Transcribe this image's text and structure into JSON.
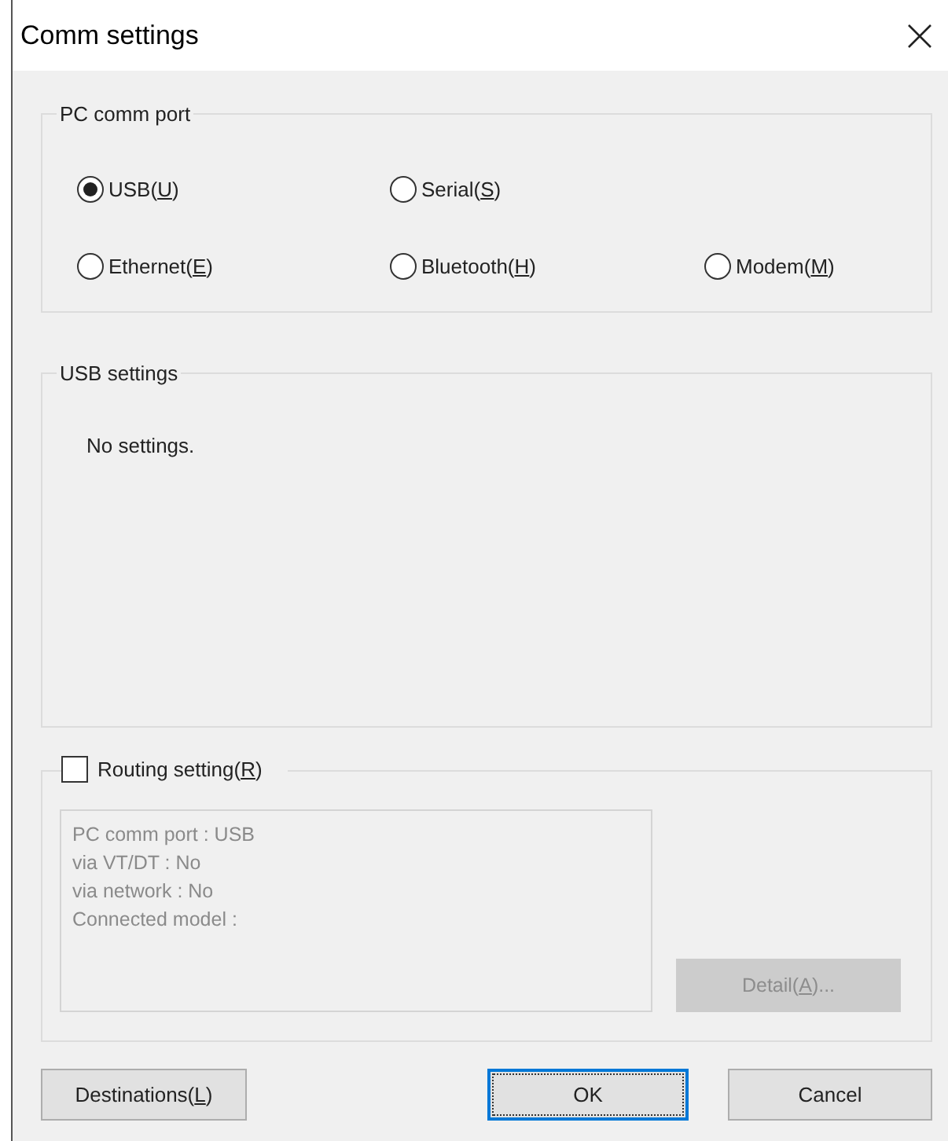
{
  "window": {
    "title": "Comm settings"
  },
  "pc_comm_port": {
    "title": "PC comm port",
    "options": [
      {
        "before": "USB(",
        "key": "U",
        "after": ")",
        "selected": true
      },
      {
        "before": "Serial(",
        "key": "S",
        "after": ")",
        "selected": false
      },
      {
        "before": "Ethernet(",
        "key": "E",
        "after": ")",
        "selected": false
      },
      {
        "before": "Bluetooth(",
        "key": "H",
        "after": ")",
        "selected": false
      },
      {
        "before": "Modem(",
        "key": "M",
        "after": ")",
        "selected": false
      }
    ]
  },
  "usb_settings": {
    "title": "USB settings",
    "message": "No settings."
  },
  "routing": {
    "before": "Routing setting(",
    "key": "R",
    "after": ")",
    "checked": false,
    "summary": [
      "PC comm port : USB",
      "via VT/DT : No",
      "via network : No",
      "Connected model :"
    ],
    "detail_button": {
      "before": "Detail(",
      "key": "A",
      "after": ")...",
      "disabled": true
    }
  },
  "buttons": [
    {
      "kind": "destinations",
      "before": "Destinations(",
      "key": "L",
      "after": ")"
    },
    {
      "kind": "ok",
      "label": "OK",
      "default": true
    },
    {
      "kind": "cancel",
      "label": "Cancel",
      "default": false
    }
  ]
}
